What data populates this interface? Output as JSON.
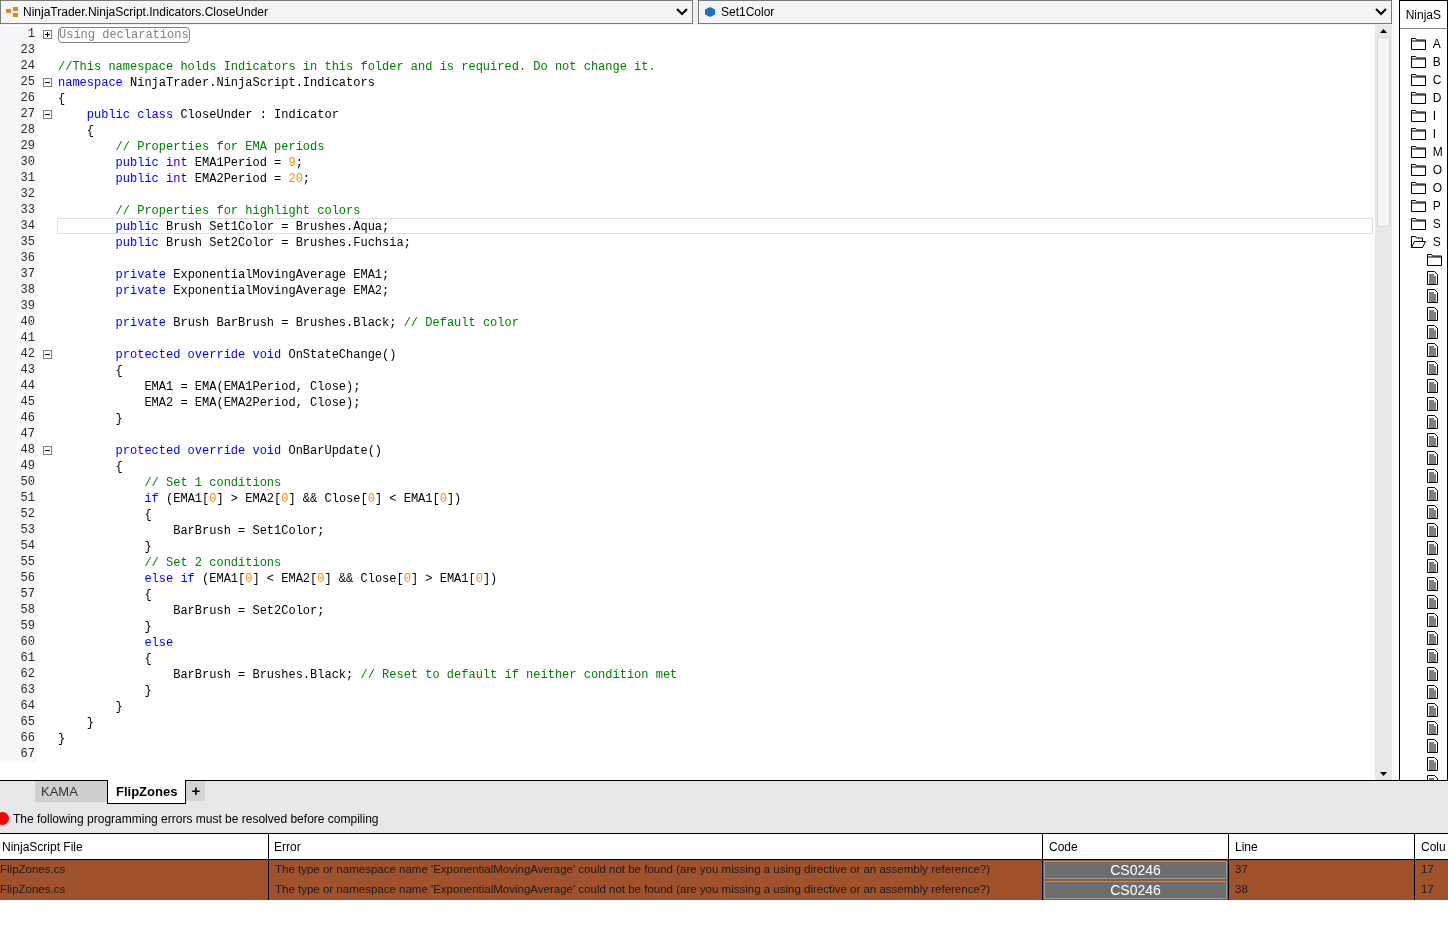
{
  "type_dropdown": {
    "value": "NinjaTrader.NinjaScript.Indicators.CloseUnder"
  },
  "member_dropdown": {
    "value": "Set1Color"
  },
  "editor": {
    "lines": [
      {
        "num": "1",
        "expanded": false,
        "current": false,
        "tokens": [
          {
            "kind": "region",
            "t": "Using declarations"
          }
        ]
      },
      {
        "num": "23",
        "current": false
      },
      {
        "num": "24",
        "current": false,
        "tokens": [
          {
            "kind": "comment",
            "t": "//This namespace holds Indicators in this folder and is required. Do not change it."
          }
        ]
      },
      {
        "num": "25",
        "expanded": true,
        "current": false,
        "tokens": [
          {
            "kind": "keyword",
            "t": "namespace"
          },
          {
            "kind": "plain",
            "t": " NinjaTrader.NinjaScript.Indicators"
          }
        ]
      },
      {
        "num": "26",
        "current": false,
        "tokens": [
          {
            "kind": "plain",
            "t": "{"
          }
        ]
      },
      {
        "num": "27",
        "expanded": true,
        "current": false,
        "tokens": [
          {
            "kind": "keyword",
            "t": "    public class"
          },
          {
            "kind": "plain",
            "t": " CloseUnder : Indicator"
          }
        ]
      },
      {
        "num": "28",
        "current": false,
        "tokens": [
          {
            "kind": "plain",
            "t": "    {"
          }
        ]
      },
      {
        "num": "29",
        "current": false,
        "tokens": [
          {
            "kind": "comment",
            "t": "        // Properties for EMA periods"
          }
        ]
      },
      {
        "num": "30",
        "current": false,
        "tokens": [
          {
            "kind": "keyword",
            "t": "        public int"
          },
          {
            "kind": "plain",
            "t": " EMA1Period = "
          },
          {
            "kind": "number",
            "t": "9"
          },
          {
            "kind": "plain",
            "t": ";"
          }
        ]
      },
      {
        "num": "31",
        "current": false,
        "tokens": [
          {
            "kind": "keyword",
            "t": "        public int"
          },
          {
            "kind": "plain",
            "t": " EMA2Period = "
          },
          {
            "kind": "number",
            "t": "20"
          },
          {
            "kind": "plain",
            "t": ";"
          }
        ]
      },
      {
        "num": "32",
        "current": false
      },
      {
        "num": "33",
        "current": false,
        "tokens": [
          {
            "kind": "comment",
            "t": "        // Properties for highlight colors"
          }
        ]
      },
      {
        "num": "34",
        "current": true,
        "tokens": [
          {
            "kind": "keyword",
            "t": "        public"
          },
          {
            "kind": "plain",
            "t": " Brush Set1Color = Brushes.Aqua;"
          }
        ]
      },
      {
        "num": "35",
        "current": false,
        "tokens": [
          {
            "kind": "keyword",
            "t": "        public"
          },
          {
            "kind": "plain",
            "t": " Brush Set2Color = Brushes.Fuchsia;"
          }
        ]
      },
      {
        "num": "36",
        "current": false
      },
      {
        "num": "37",
        "current": false,
        "tokens": [
          {
            "kind": "keyword",
            "t": "        private"
          },
          {
            "kind": "plain",
            "t": " ExponentialMovingAverage EMA1;"
          }
        ]
      },
      {
        "num": "38",
        "current": false,
        "tokens": [
          {
            "kind": "keyword",
            "t": "        private"
          },
          {
            "kind": "plain",
            "t": " ExponentialMovingAverage EMA2;"
          }
        ]
      },
      {
        "num": "39",
        "current": false
      },
      {
        "num": "40",
        "current": false,
        "tokens": [
          {
            "kind": "keyword",
            "t": "        private"
          },
          {
            "kind": "plain",
            "t": " Brush BarBrush = Brushes.Black; "
          },
          {
            "kind": "comment",
            "t": "// Default color"
          }
        ]
      },
      {
        "num": "41",
        "current": false
      },
      {
        "num": "42",
        "expanded": true,
        "current": false,
        "tokens": [
          {
            "kind": "keyword",
            "t": "        protected override void"
          },
          {
            "kind": "plain",
            "t": " OnStateChange()"
          }
        ]
      },
      {
        "num": "43",
        "current": false,
        "tokens": [
          {
            "kind": "plain",
            "t": "        {"
          }
        ]
      },
      {
        "num": "44",
        "current": false,
        "tokens": [
          {
            "kind": "plain",
            "t": "            EMA1 = EMA(EMA1Period, Close);"
          }
        ]
      },
      {
        "num": "45",
        "current": false,
        "tokens": [
          {
            "kind": "plain",
            "t": "            EMA2 = EMA(EMA2Period, Close);"
          }
        ]
      },
      {
        "num": "46",
        "current": false,
        "tokens": [
          {
            "kind": "plain",
            "t": "        }"
          }
        ]
      },
      {
        "num": "47",
        "current": false
      },
      {
        "num": "48",
        "expanded": true,
        "current": false,
        "tokens": [
          {
            "kind": "keyword",
            "t": "        protected override void"
          },
          {
            "kind": "plain",
            "t": " OnBarUpdate()"
          }
        ]
      },
      {
        "num": "49",
        "current": false,
        "tokens": [
          {
            "kind": "plain",
            "t": "        {"
          }
        ]
      },
      {
        "num": "50",
        "current": false,
        "tokens": [
          {
            "kind": "comment",
            "t": "            // Set 1 conditions"
          }
        ]
      },
      {
        "num": "51",
        "current": false,
        "tokens": [
          {
            "kind": "keyword",
            "t": "            if"
          },
          {
            "kind": "plain",
            "t": " (EMA1["
          },
          {
            "kind": "number",
            "t": "0"
          },
          {
            "kind": "plain",
            "t": "] > EMA2["
          },
          {
            "kind": "number",
            "t": "0"
          },
          {
            "kind": "plain",
            "t": "] && Close["
          },
          {
            "kind": "number",
            "t": "0"
          },
          {
            "kind": "plain",
            "t": "] < EMA1["
          },
          {
            "kind": "number",
            "t": "0"
          },
          {
            "kind": "plain",
            "t": "])"
          }
        ]
      },
      {
        "num": "52",
        "current": false,
        "tokens": [
          {
            "kind": "plain",
            "t": "            {"
          }
        ]
      },
      {
        "num": "53",
        "current": false,
        "tokens": [
          {
            "kind": "plain",
            "t": "                BarBrush = Set1Color;"
          }
        ]
      },
      {
        "num": "54",
        "current": false,
        "tokens": [
          {
            "kind": "plain",
            "t": "            }"
          }
        ]
      },
      {
        "num": "55",
        "current": false,
        "tokens": [
          {
            "kind": "comment",
            "t": "            // Set 2 conditions"
          }
        ]
      },
      {
        "num": "56",
        "current": false,
        "tokens": [
          {
            "kind": "keyword",
            "t": "            else if"
          },
          {
            "kind": "plain",
            "t": " (EMA1["
          },
          {
            "kind": "number",
            "t": "0"
          },
          {
            "kind": "plain",
            "t": "] < EMA2["
          },
          {
            "kind": "number",
            "t": "0"
          },
          {
            "kind": "plain",
            "t": "] && Close["
          },
          {
            "kind": "number",
            "t": "0"
          },
          {
            "kind": "plain",
            "t": "] > EMA1["
          },
          {
            "kind": "number",
            "t": "0"
          },
          {
            "kind": "plain",
            "t": "])"
          }
        ]
      },
      {
        "num": "57",
        "current": false,
        "tokens": [
          {
            "kind": "plain",
            "t": "            {"
          }
        ]
      },
      {
        "num": "58",
        "current": false,
        "tokens": [
          {
            "kind": "plain",
            "t": "                BarBrush = Set2Color;"
          }
        ]
      },
      {
        "num": "59",
        "current": false,
        "tokens": [
          {
            "kind": "plain",
            "t": "            }"
          }
        ]
      },
      {
        "num": "60",
        "current": false,
        "tokens": [
          {
            "kind": "keyword",
            "t": "            else"
          }
        ]
      },
      {
        "num": "61",
        "current": false,
        "tokens": [
          {
            "kind": "plain",
            "t": "            {"
          }
        ]
      },
      {
        "num": "62",
        "current": false,
        "tokens": [
          {
            "kind": "plain",
            "t": "                BarBrush = Brushes.Black; "
          },
          {
            "kind": "comment",
            "t": "// Reset to default if neither condition met"
          }
        ]
      },
      {
        "num": "63",
        "current": false,
        "tokens": [
          {
            "kind": "plain",
            "t": "            }"
          }
        ]
      },
      {
        "num": "64",
        "current": false,
        "tokens": [
          {
            "kind": "plain",
            "t": "        }"
          }
        ]
      },
      {
        "num": "65",
        "current": false,
        "tokens": [
          {
            "kind": "plain",
            "t": "    }"
          }
        ]
      },
      {
        "num": "66",
        "current": false,
        "tokens": [
          {
            "kind": "plain",
            "t": "}"
          }
        ]
      },
      {
        "num": "67",
        "current": false
      }
    ]
  },
  "explorer": {
    "title": "NinjaS",
    "items": [
      {
        "label": "A",
        "expanded": false
      },
      {
        "label": "B",
        "expanded": false
      },
      {
        "label": "C",
        "expanded": false
      },
      {
        "label": "D",
        "expanded": false
      },
      {
        "label": "I",
        "expanded": false
      },
      {
        "label": "I",
        "expanded": false
      },
      {
        "label": "M",
        "expanded": false
      },
      {
        "label": "O",
        "expanded": false
      },
      {
        "label": "O",
        "expanded": false
      },
      {
        "label": "P",
        "expanded": false
      },
      {
        "label": "S",
        "expanded": false
      },
      {
        "label": "S",
        "expanded": true,
        "children": [
          {
            "kind": "folder"
          },
          {
            "kind": "file"
          },
          {
            "kind": "file"
          },
          {
            "kind": "file"
          },
          {
            "kind": "file"
          },
          {
            "kind": "file"
          },
          {
            "kind": "file"
          },
          {
            "kind": "file"
          },
          {
            "kind": "file"
          },
          {
            "kind": "file"
          },
          {
            "kind": "file"
          },
          {
            "kind": "file"
          },
          {
            "kind": "file"
          },
          {
            "kind": "file"
          },
          {
            "kind": "file"
          },
          {
            "kind": "file"
          },
          {
            "kind": "file"
          },
          {
            "kind": "file"
          },
          {
            "kind": "file"
          },
          {
            "kind": "file"
          },
          {
            "kind": "file"
          },
          {
            "kind": "file"
          },
          {
            "kind": "file"
          },
          {
            "kind": "file"
          },
          {
            "kind": "file"
          },
          {
            "kind": "file"
          },
          {
            "kind": "file"
          },
          {
            "kind": "file"
          },
          {
            "kind": "file"
          },
          {
            "kind": "file"
          }
        ]
      }
    ]
  },
  "tabs": [
    {
      "label": "KAMA",
      "selected": false
    },
    {
      "label": "FlipZones",
      "selected": true
    }
  ],
  "add_tab": {
    "label": "+"
  },
  "error_banner": {
    "text": "The following programming errors must be resolved before compiling"
  },
  "errors_table": {
    "columns": [
      "NinjaScript File",
      "Error",
      "Code",
      "Line",
      "Colu"
    ],
    "rows": [
      {
        "file": "FlipZones.cs",
        "error": "The type or namespace name 'ExponentialMovingAverage' could not be found (are you missing a using directive or an assembly reference?)",
        "code": "CS0246",
        "line": "37",
        "column": "17"
      },
      {
        "file": "FlipZones.cs",
        "error": "The type or namespace name 'ExponentialMovingAverage' could not be found (are you missing a using directive or an assembly reference?)",
        "code": "CS0246",
        "line": "38",
        "column": "17"
      }
    ]
  }
}
